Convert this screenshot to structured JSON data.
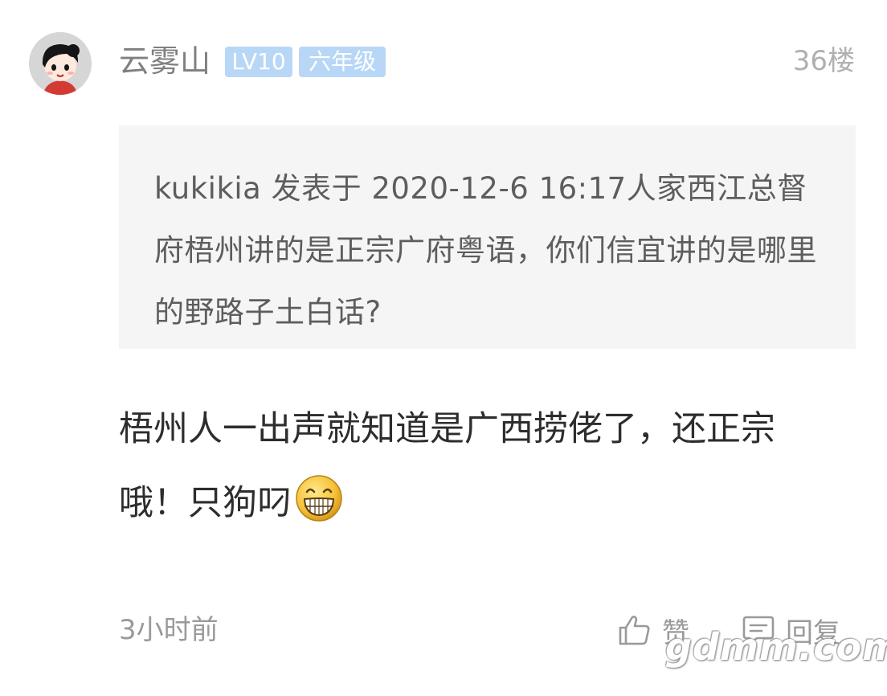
{
  "post": {
    "username": "云雾山",
    "level_badge": "LV10",
    "grade_badge": "六年级",
    "floor": "36楼",
    "quote": "kukikia 发表于 2020-12-6 16:17人家西江总督府梧州讲的是正宗广府粤语，你们信宜讲的是哪里的野路子土白话?",
    "content": "梧州人一出声就知道是广西捞佬了，还正宗哦！只狗叼",
    "emoji": "grinning-face-emoji",
    "time": "3小时前"
  },
  "actions": {
    "like_label": "赞",
    "like_icon": "thumbs-up-icon",
    "reply_label": "回复",
    "reply_icon": "comment-icon"
  },
  "watermark": {
    "text": "gdmm.com"
  },
  "colors": {
    "badge_bg": "#b8d7f7",
    "quote_bg": "#f5f5f5",
    "muted_text": "#9a9a9a"
  }
}
